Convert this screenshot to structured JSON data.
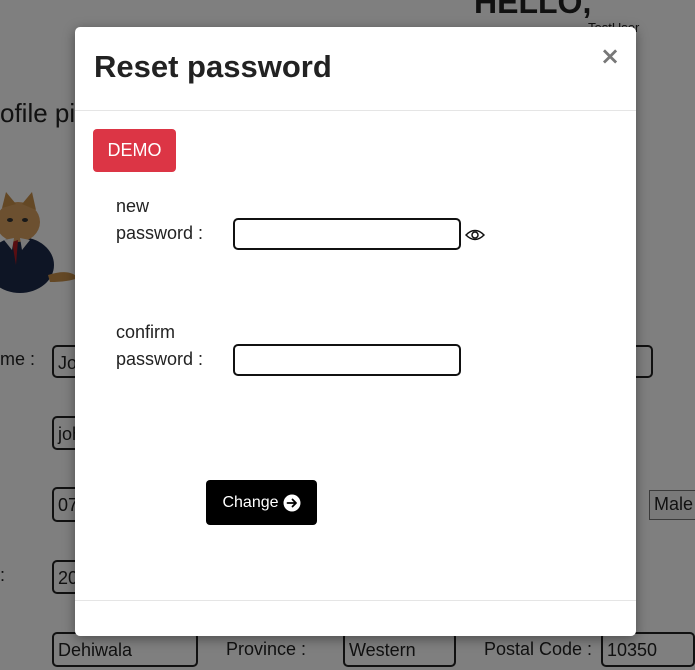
{
  "background": {
    "greeting": "HELLO,",
    "username": "TestUser",
    "profile_title": "ofile pi",
    "labels": {
      "name": "me :",
      "dob": ":",
      "province": "Province :",
      "postal_code": "Postal Code :"
    },
    "fields": {
      "first_name": "Jo",
      "email": "joh",
      "phone": "07",
      "dob": "20",
      "city": "Dehiwala",
      "province": "Western",
      "postal_code": "10350"
    },
    "gender_select": "Male"
  },
  "modal": {
    "title": "Reset password",
    "close_label": "×",
    "demo_label": "DEMO",
    "new_password": {
      "label_line1": "new",
      "label_line2": "password :",
      "value": ""
    },
    "confirm_password": {
      "label_line1": "confirm",
      "label_line2": "password :",
      "value": ""
    },
    "change_label": "Change",
    "icons": {
      "visibility": "eye-icon",
      "submit": "arrow-right-circle-icon",
      "close": "close-icon"
    }
  },
  "colors": {
    "demo": "#dc3545",
    "change": "#000000",
    "overlay": "rgba(0,0,0,0.5)"
  }
}
